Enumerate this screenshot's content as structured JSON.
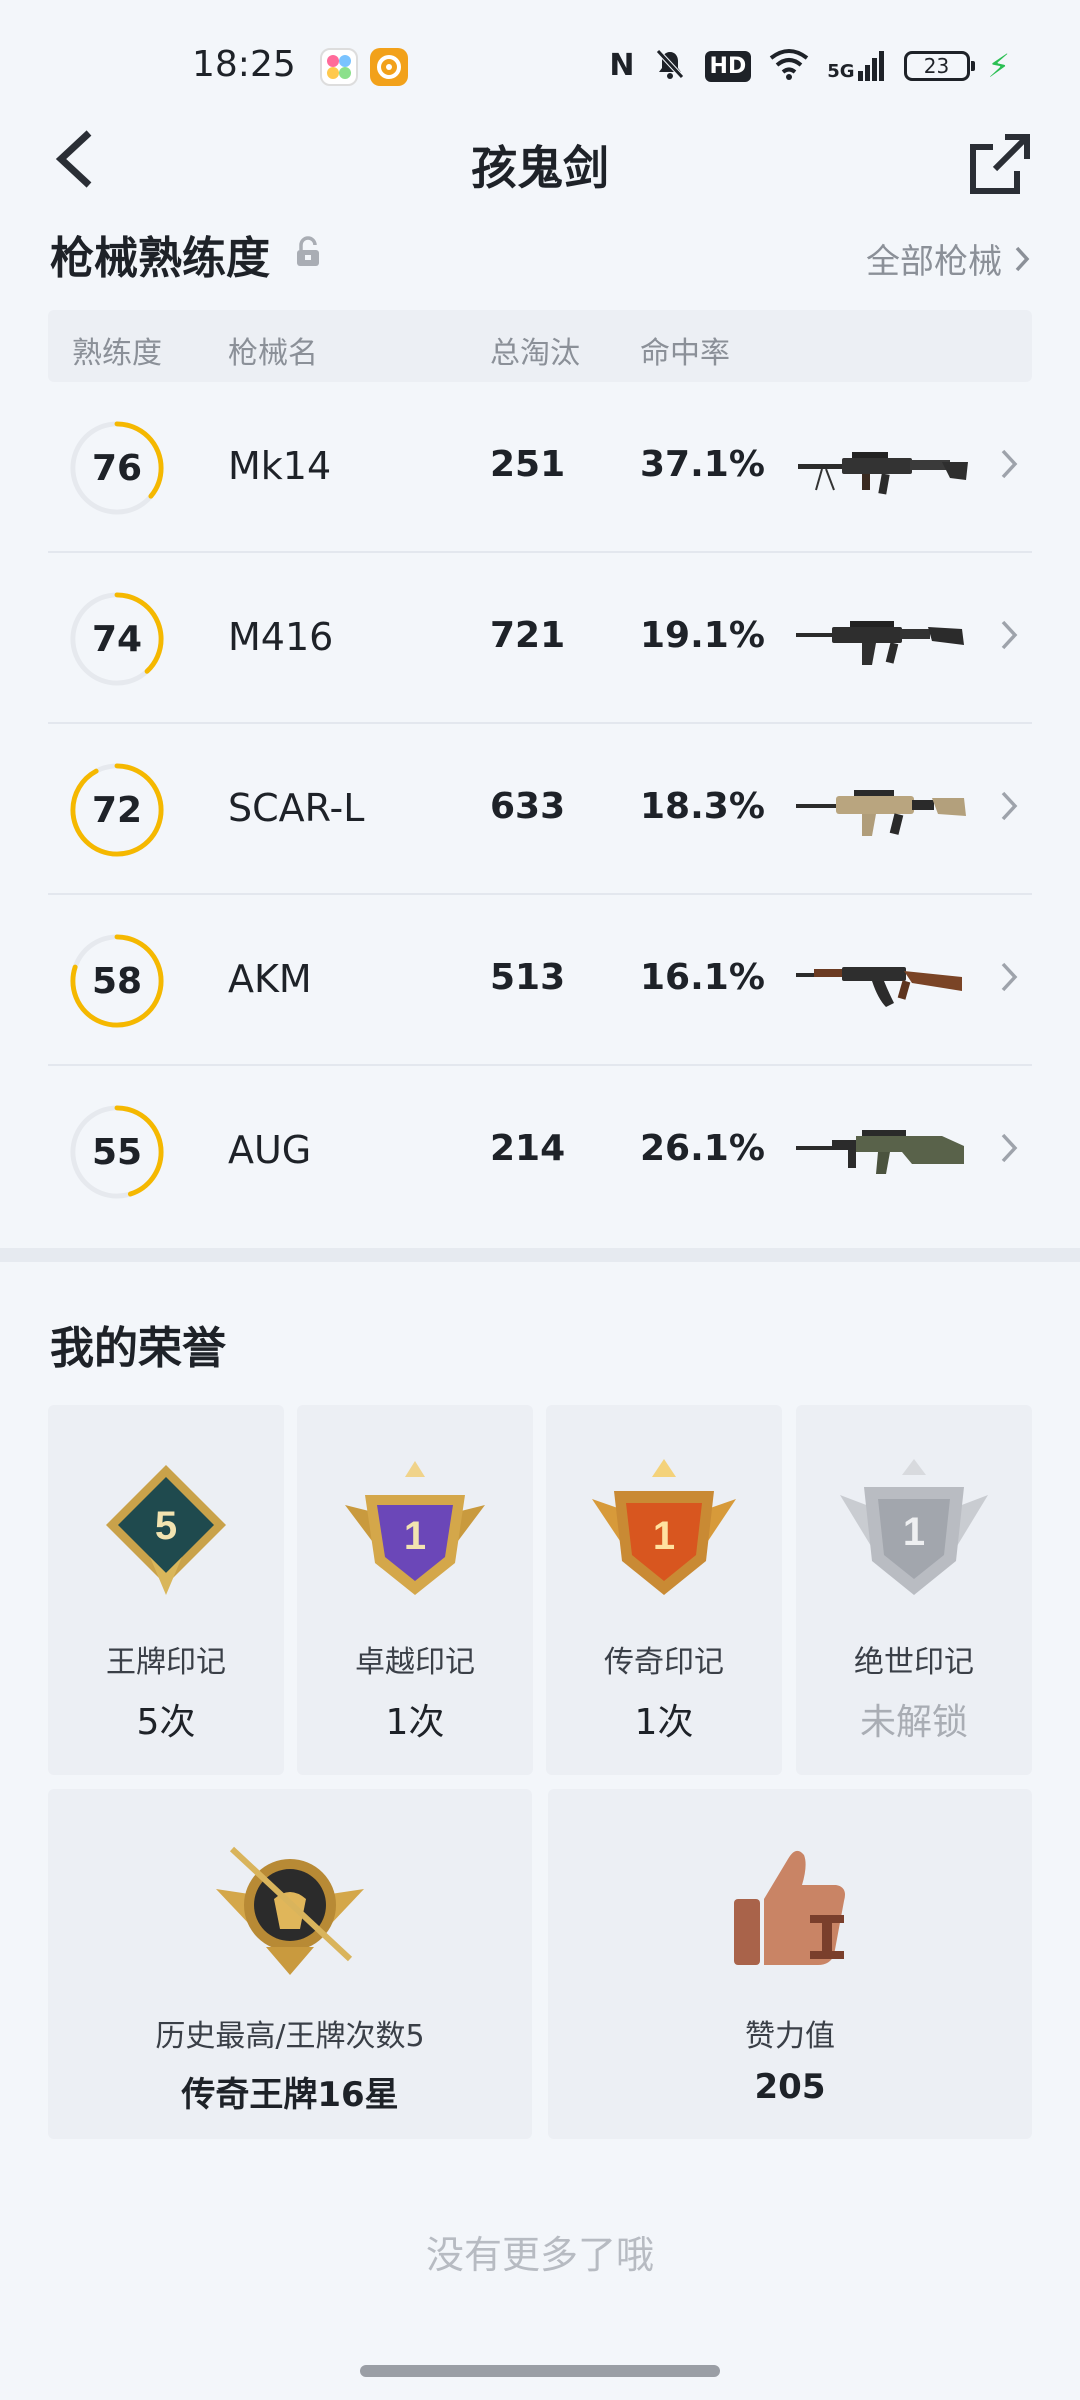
{
  "status_bar": {
    "time": "18:25",
    "battery": "23",
    "network": "5G",
    "hd": "HD",
    "nfc": "N",
    "icons": [
      "nfc-icon",
      "bell-off-icon",
      "hd-icon",
      "wifi-icon",
      "signal-5g-icon",
      "battery-icon",
      "charging-icon"
    ]
  },
  "header": {
    "title": "孩鬼剑",
    "back_icon": "back-chevron-icon",
    "share_icon": "share-external-icon"
  },
  "weapons": {
    "title": "枪械熟练度",
    "lock_icon": "lock-icon",
    "all_link": "全部枪械",
    "columns": [
      "熟练度",
      "枪械名",
      "总淘汰",
      "命中率"
    ],
    "rows": [
      {
        "proficiency": "76",
        "name": "Mk14",
        "kills": "251",
        "accuracy": "37.1%",
        "ring_fill": 0.36
      },
      {
        "proficiency": "74",
        "name": "M416",
        "kills": "721",
        "accuracy": "19.1%",
        "ring_fill": 0.38
      },
      {
        "proficiency": "72",
        "name": "SCAR-L",
        "kills": "633",
        "accuracy": "18.3%",
        "ring_fill": 0.92
      },
      {
        "proficiency": "58",
        "name": "AKM",
        "kills": "513",
        "accuracy": "16.1%",
        "ring_fill": 0.8
      },
      {
        "proficiency": "55",
        "name": "AUG",
        "kills": "214",
        "accuracy": "26.1%",
        "ring_fill": 0.45
      }
    ],
    "accent_color": "#f5b800"
  },
  "honors": {
    "title": "我的荣誉",
    "cards": [
      {
        "label": "王牌印记",
        "value": "5次",
        "badge": "5"
      },
      {
        "label": "卓越印记",
        "value": "1次",
        "badge": "1"
      },
      {
        "label": "传奇印记",
        "value": "1次",
        "badge": "1"
      },
      {
        "label": "绝世印记",
        "value": "未解锁",
        "badge": "1"
      }
    ],
    "highest": {
      "label": "历史最高/王牌次数5",
      "value": "传奇王牌16星"
    },
    "likes": {
      "label": "赞力值",
      "value": "205"
    }
  },
  "footer": {
    "no_more": "没有更多了哦"
  }
}
